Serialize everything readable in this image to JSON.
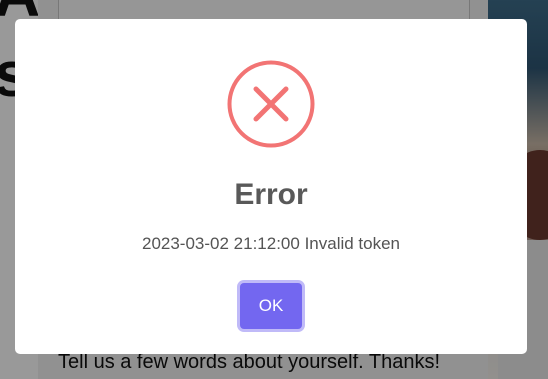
{
  "background": {
    "form_text": "Tell us a few words about yourself. Thanks!"
  },
  "dialog": {
    "icon": "error-x-icon",
    "title": "Error",
    "message": "2023-03-02 21:12:00 Invalid token",
    "confirm_label": "OK",
    "colors": {
      "icon": "#f27474",
      "confirm_button": "#7367f0",
      "title": "#595959",
      "message": "#545454"
    }
  }
}
